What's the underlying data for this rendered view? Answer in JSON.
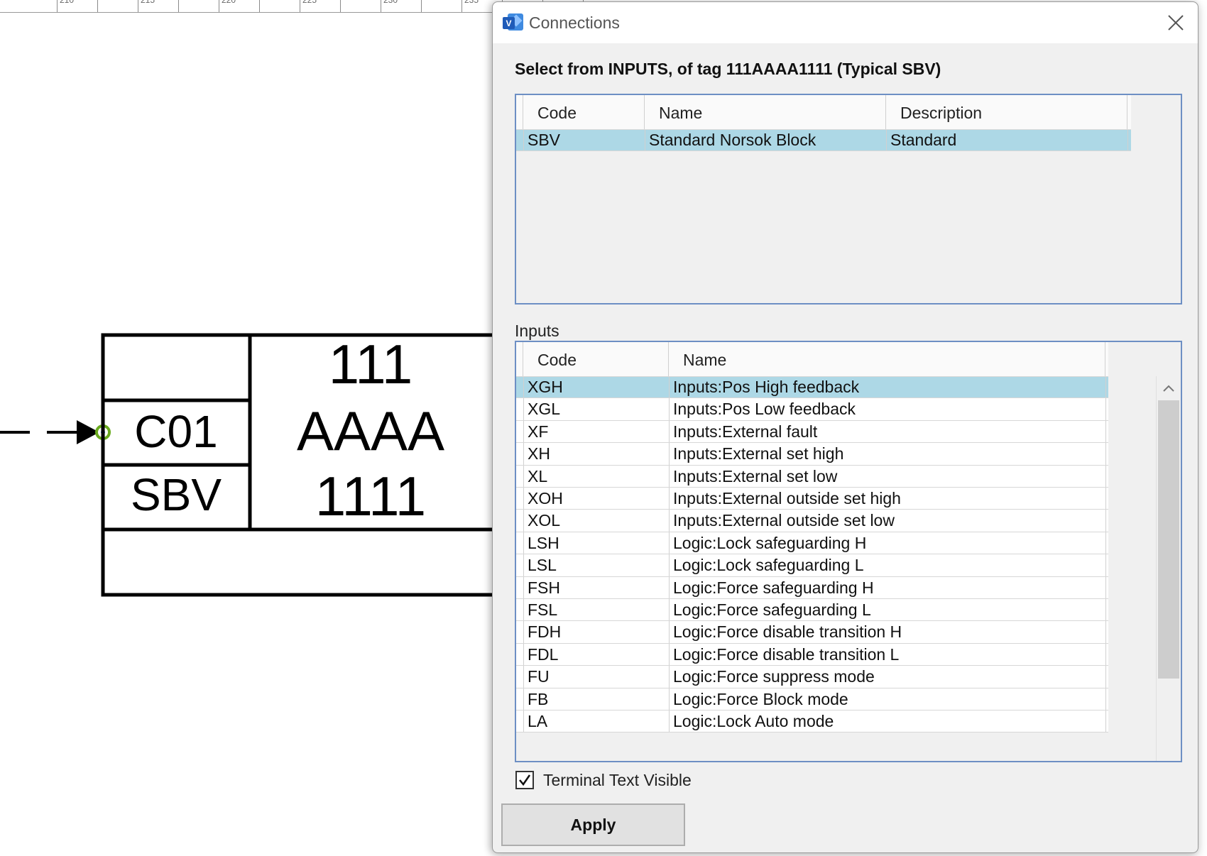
{
  "ruler": {
    "labels": [
      "210",
      "215",
      "220",
      "225",
      "230",
      "235"
    ]
  },
  "diagram": {
    "terminal_code": "C01",
    "block_type": "SBV",
    "tag_line1": "111",
    "tag_line2": "AAAA",
    "tag_line3": "1111",
    "connector_color": "#6aaa1e"
  },
  "dialog": {
    "title": "Connections",
    "prompt": "Select from INPUTS, of tag 111AAAA1111 (Typical SBV)",
    "typicals": {
      "columns": [
        "Code",
        "Name",
        "Description"
      ],
      "rows": [
        {
          "code": "SBV",
          "name": "Standard Norsok Block",
          "description": "Standard",
          "selected": true
        }
      ]
    },
    "inputs_label": "Inputs",
    "inputs": {
      "columns": [
        "Code",
        "Name"
      ],
      "rows": [
        {
          "code": "XGH",
          "name": "Inputs:Pos High feedback",
          "selected": true
        },
        {
          "code": "XGL",
          "name": "Inputs:Pos Low feedback"
        },
        {
          "code": "XF",
          "name": "Inputs:External fault"
        },
        {
          "code": "XH",
          "name": "Inputs:External set high"
        },
        {
          "code": "XL",
          "name": "Inputs:External set low"
        },
        {
          "code": "XOH",
          "name": "Inputs:External outside set high"
        },
        {
          "code": "XOL",
          "name": "Inputs:External outside set low"
        },
        {
          "code": "LSH",
          "name": "Logic:Lock safeguarding H"
        },
        {
          "code": "LSL",
          "name": "Logic:Lock safeguarding L"
        },
        {
          "code": "FSH",
          "name": "Logic:Force safeguarding H"
        },
        {
          "code": "FSL",
          "name": "Logic:Force safeguarding L"
        },
        {
          "code": "FDH",
          "name": "Logic:Force disable transition H"
        },
        {
          "code": "FDL",
          "name": "Logic:Force disable transition L"
        },
        {
          "code": "FU",
          "name": "Logic:Force suppress mode"
        },
        {
          "code": "FB",
          "name": "Logic:Force Block mode"
        },
        {
          "code": "LA",
          "name": "Logic:Lock Auto mode"
        }
      ]
    },
    "terminal_text_visible_label": "Terminal Text Visible",
    "terminal_text_visible": true,
    "apply_label": "Apply",
    "colors": {
      "selection": "#add8e6",
      "grid_border": "#6d8fc4",
      "icon_blue": "#2b6cc4"
    },
    "icons": [
      "visio-app-icon",
      "close-icon",
      "chevron-up-icon",
      "chevron-down-icon",
      "checkmark-icon"
    ]
  }
}
